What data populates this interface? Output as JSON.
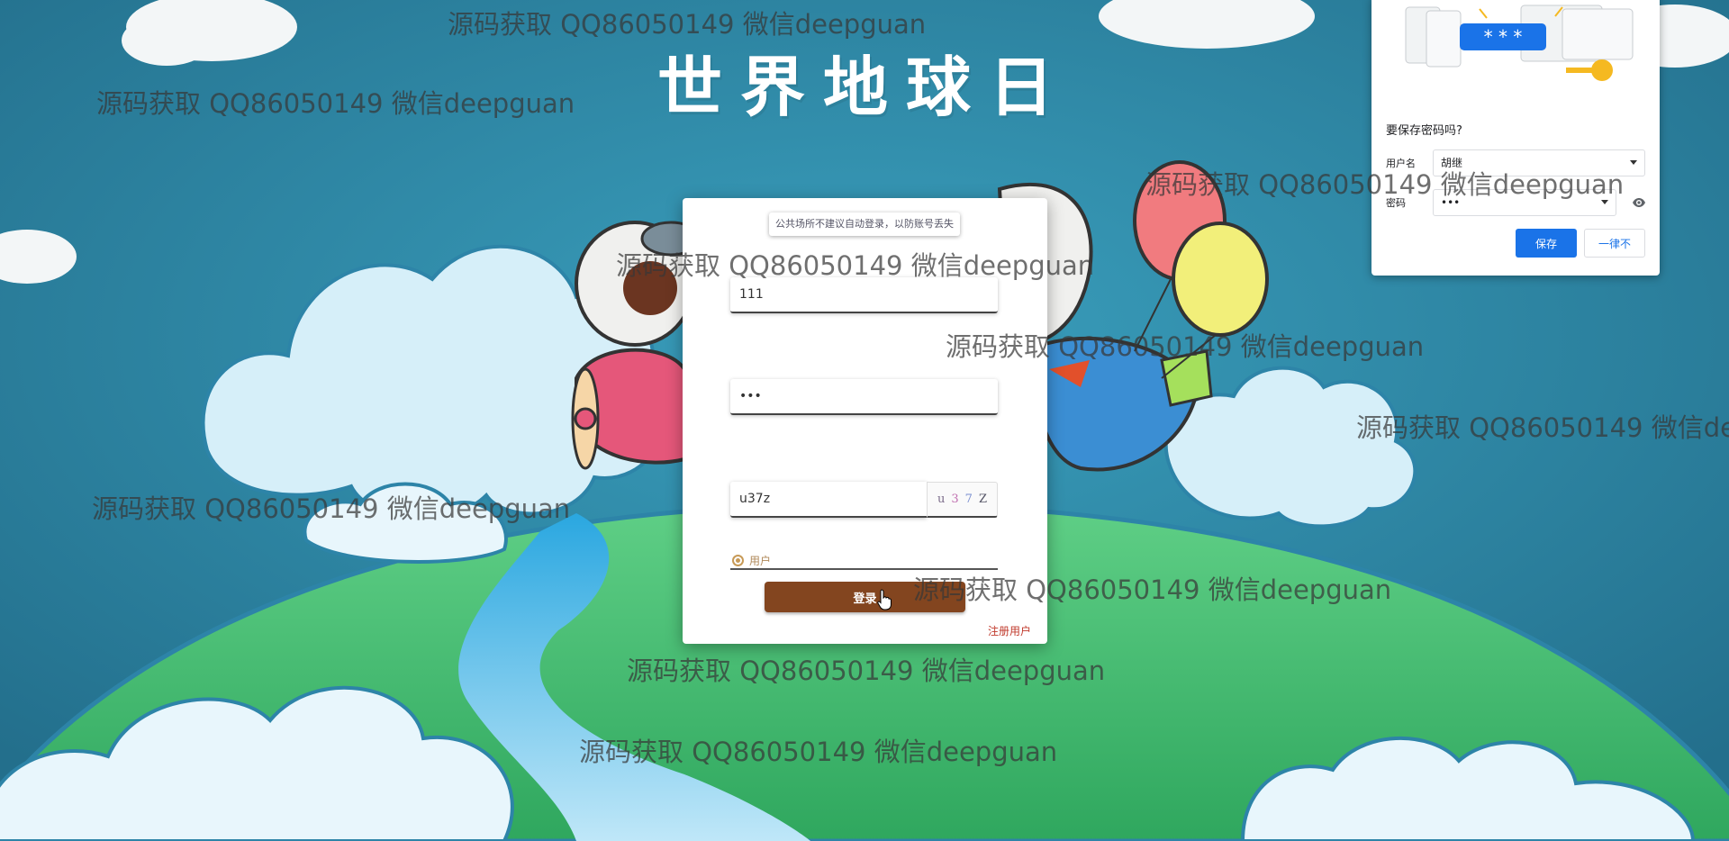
{
  "page": {
    "title": "世界地球日"
  },
  "login": {
    "notice": "公共场所不建议自动登录，以防账号丢失",
    "username_value": "111",
    "password_value": "•••",
    "captcha_value": "u37z",
    "captcha_chars": [
      "u",
      "3",
      "7",
      "Z"
    ],
    "role_label": "用户",
    "login_button": "登录",
    "register_link": "注册用户"
  },
  "password_popup": {
    "question": "要保存密码吗?",
    "username_label": "用户名",
    "username_value": "胡继",
    "password_label": "密码",
    "password_value": "•••",
    "masked_badge": "* * *",
    "save_button": "保存",
    "never_button": "一律不"
  },
  "watermark_text": "源码获取 QQ86050149 微信deepguan",
  "colors": {
    "sky": "#2f8aa6",
    "login_button": "#83451f",
    "register_link": "#c0392b",
    "popup_accent": "#1a73e8"
  }
}
